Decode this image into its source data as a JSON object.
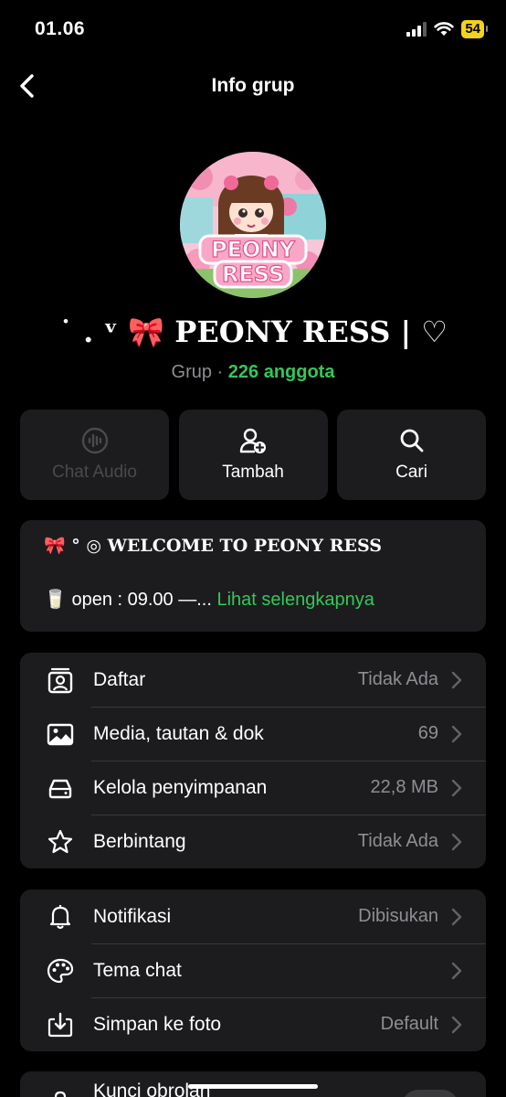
{
  "status": {
    "time": "01.06",
    "battery": "54"
  },
  "nav": {
    "title": "Info grup"
  },
  "group": {
    "name": "˙ . ᵛ 🎀 PEONY RESS | ♡",
    "type_label": "Grup ·",
    "members": "226 anggota",
    "avatar_text_1": "PEONY",
    "avatar_text_2": "RESS"
  },
  "actions": {
    "audio": "Chat Audio",
    "add": "Tambah",
    "search": "Cari"
  },
  "description": {
    "line1": "🎀 ° ◎ WELCOME TO PEONY RESS",
    "line2_prefix": "🥛 open   :   09.00 —...",
    "more": " Lihat selengkapnya"
  },
  "list1": [
    {
      "label": "Daftar",
      "value": "Tidak Ada",
      "icon": "list-person-icon"
    },
    {
      "label": "Media, tautan & dok",
      "value": "69",
      "icon": "photo-icon"
    },
    {
      "label": "Kelola penyimpanan",
      "value": "22,8 MB",
      "icon": "storage-drive-icon"
    },
    {
      "label": "Berbintang",
      "value": "Tidak Ada",
      "icon": "star-icon"
    }
  ],
  "list2": [
    {
      "label": "Notifikasi",
      "value": "Dibisukan",
      "icon": "bell-icon"
    },
    {
      "label": "Tema chat",
      "value": "",
      "icon": "palette-icon"
    },
    {
      "label": "Simpan ke foto",
      "value": "Default",
      "icon": "save-download-icon"
    }
  ],
  "list3": [
    {
      "label": "Kunci obrolan",
      "icon": "lock-icon"
    }
  ]
}
